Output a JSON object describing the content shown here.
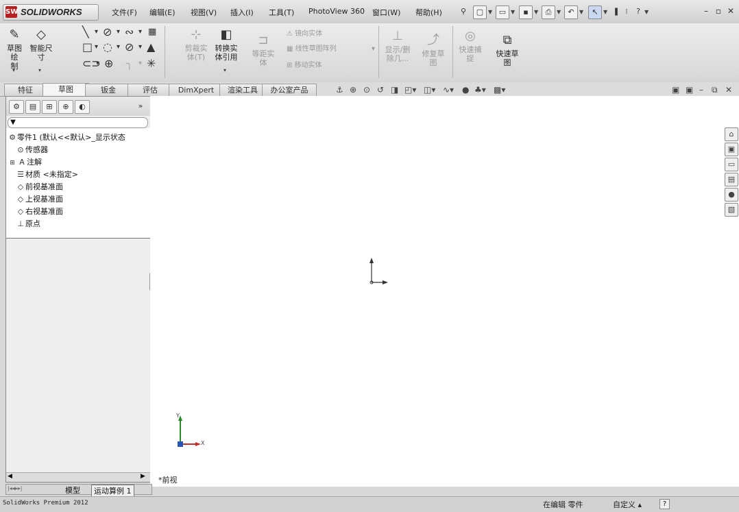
{
  "app": {
    "logo_text": "SOLIDWORKS",
    "logo_mark": "SW"
  },
  "menu": [
    {
      "label": "文件(F)"
    },
    {
      "label": "编辑(E)"
    },
    {
      "label": "视图(V)"
    },
    {
      "label": "插入(I)"
    },
    {
      "label": "工具(T)"
    },
    {
      "label": "PhotoView 360"
    },
    {
      "label": "窗口(W)"
    },
    {
      "label": "帮助(H)"
    }
  ],
  "quick_icons": [
    "pin-icon",
    "new-icon",
    "open-icon",
    "save-icon",
    "print-icon",
    "undo-icon",
    "select-icon",
    "rebuild-icon",
    "options-icon",
    "help-icon"
  ],
  "ribbon": {
    "sketch": {
      "l1": "草图绘",
      "l2": "制"
    },
    "smart_dim": {
      "l1": "智能尺",
      "l2": "寸"
    },
    "trim": {
      "l1": "剪裁实",
      "l2": "体(T)"
    },
    "convert": {
      "l1": "转换实",
      "l2": "体引用"
    },
    "offset": {
      "l1": "等距实",
      "l2": "体"
    },
    "mirror": "镜向实体",
    "linear_pattern": "线性草图阵列",
    "move": "移动实体",
    "display_relations": {
      "l1": "显示/删",
      "l2": "除几..."
    },
    "repair": {
      "l1": "修复草",
      "l2": "图"
    },
    "rapid_snaps": {
      "l1": "快速捕",
      "l2": "捉"
    },
    "rapid_sketch": {
      "l1": "快速草",
      "l2": "图"
    }
  },
  "tabs": [
    {
      "label": "特征"
    },
    {
      "label": "草图"
    },
    {
      "label": "钣金"
    },
    {
      "label": "评估"
    },
    {
      "label": "DimXpert"
    },
    {
      "label": "渲染工具"
    },
    {
      "label": "办公室产品"
    }
  ],
  "feature_tree": {
    "root": "零件1  (默认<<默认>_显示状态",
    "items": [
      {
        "label": "传感器",
        "icon": "sensor-icon"
      },
      {
        "label": "注解",
        "icon": "annotation-icon"
      },
      {
        "label": "材质 <未指定>",
        "icon": "material-icon"
      },
      {
        "label": "前视基准面",
        "icon": "plane-icon"
      },
      {
        "label": "上视基准面",
        "icon": "plane-icon"
      },
      {
        "label": "右视基准面",
        "icon": "plane-icon"
      },
      {
        "label": "原点",
        "icon": "origin-icon"
      }
    ]
  },
  "view_label": "*前视",
  "triad": {
    "x": "X",
    "y": "Y"
  },
  "bottom_tabs": [
    {
      "label": "模型"
    },
    {
      "label": "运动算例 1"
    }
  ],
  "status": {
    "left": "SolidWorks Premium 2012",
    "editing": "在编辑 零件",
    "custom": "自定义 ▴",
    "help": "?"
  }
}
